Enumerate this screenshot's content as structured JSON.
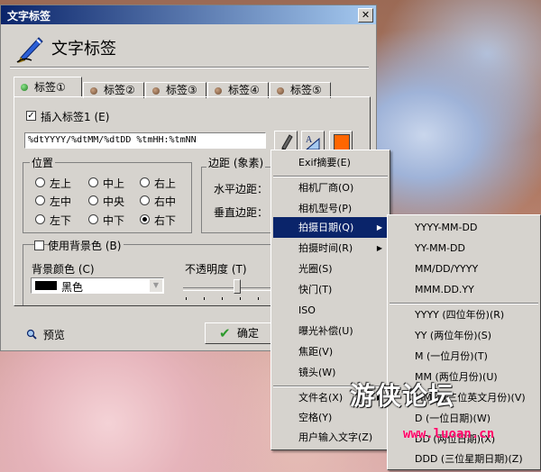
{
  "window": {
    "title": "文字标签",
    "close_glyph": "✕"
  },
  "header": {
    "title": "文字标签",
    "icon": "pen-icon"
  },
  "tabs": [
    {
      "label": "标签①",
      "active": true
    },
    {
      "label": "标签②"
    },
    {
      "label": "标签③"
    },
    {
      "label": "标签④"
    },
    {
      "label": "标签⑤"
    }
  ],
  "insert_label": {
    "label": "插入标签1 (E)",
    "checked": true
  },
  "format_field": {
    "value": "%dtYYYY/%dtMM/%dtDD %tmHH:%tmNN"
  },
  "toolbar": {
    "pen": "pen-icon",
    "font": "font-icon",
    "color": "#ff6600"
  },
  "position": {
    "title": "位置",
    "options": [
      {
        "label": "左上"
      },
      {
        "label": "中上"
      },
      {
        "label": "右上"
      },
      {
        "label": "左中"
      },
      {
        "label": "中央"
      },
      {
        "label": "右中"
      },
      {
        "label": "左下"
      },
      {
        "label": "中下"
      },
      {
        "label": "右下",
        "selected": true
      }
    ]
  },
  "margin": {
    "title": "边距 (象素)",
    "horizontal": "水平边距：",
    "vertical": "垂直边距："
  },
  "background": {
    "use_label": "使用背景色 (B)",
    "checked": false,
    "color_label": "背景颜色 (C)",
    "color_name": "黑色",
    "opacity_label": "不透明度 (T)",
    "opacity_value": 0.6
  },
  "footer": {
    "preview": "预览",
    "ok": "确定"
  },
  "context_menu": {
    "items": [
      {
        "label": "Exif摘要(E)"
      },
      {
        "sep": true
      },
      {
        "label": "相机厂商(O)"
      },
      {
        "label": "相机型号(P)"
      },
      {
        "label": "拍摄日期(Q)",
        "submenu": true,
        "selected": true
      },
      {
        "label": "拍摄时间(R)",
        "submenu": true
      },
      {
        "label": "光圈(S)"
      },
      {
        "label": "快门(T)"
      },
      {
        "label": "ISO"
      },
      {
        "label": "曝光补偿(U)"
      },
      {
        "label": "焦距(V)"
      },
      {
        "label": "镜头(W)"
      },
      {
        "sep": true
      },
      {
        "label": "文件名(X)",
        "submenu": true
      },
      {
        "label": "空格(Y)"
      },
      {
        "label": "用户输入文字(Z)"
      }
    ]
  },
  "date_submenu": {
    "items": [
      {
        "label": "YYYY-MM-DD"
      },
      {
        "label": "YY-MM-DD"
      },
      {
        "label": "MM/DD/YYYY"
      },
      {
        "label": "MMM.DD.YY"
      },
      {
        "sep": true
      },
      {
        "label": "YYYY (四位年份)(R)"
      },
      {
        "label": "YY (两位年份)(S)"
      },
      {
        "label": "M (一位月份)(T)"
      },
      {
        "label": "MM (两位月份)(U)"
      },
      {
        "label": "MMM (三位英文月份)(V)"
      },
      {
        "label": "D (一位日期)(W)"
      },
      {
        "label": "DD (两位日期)(X)"
      },
      {
        "label": "DDD (三位星期日期)(Z)"
      }
    ]
  },
  "watermark": {
    "text": "游侠论坛",
    "url": "www.luoan.cn"
  }
}
